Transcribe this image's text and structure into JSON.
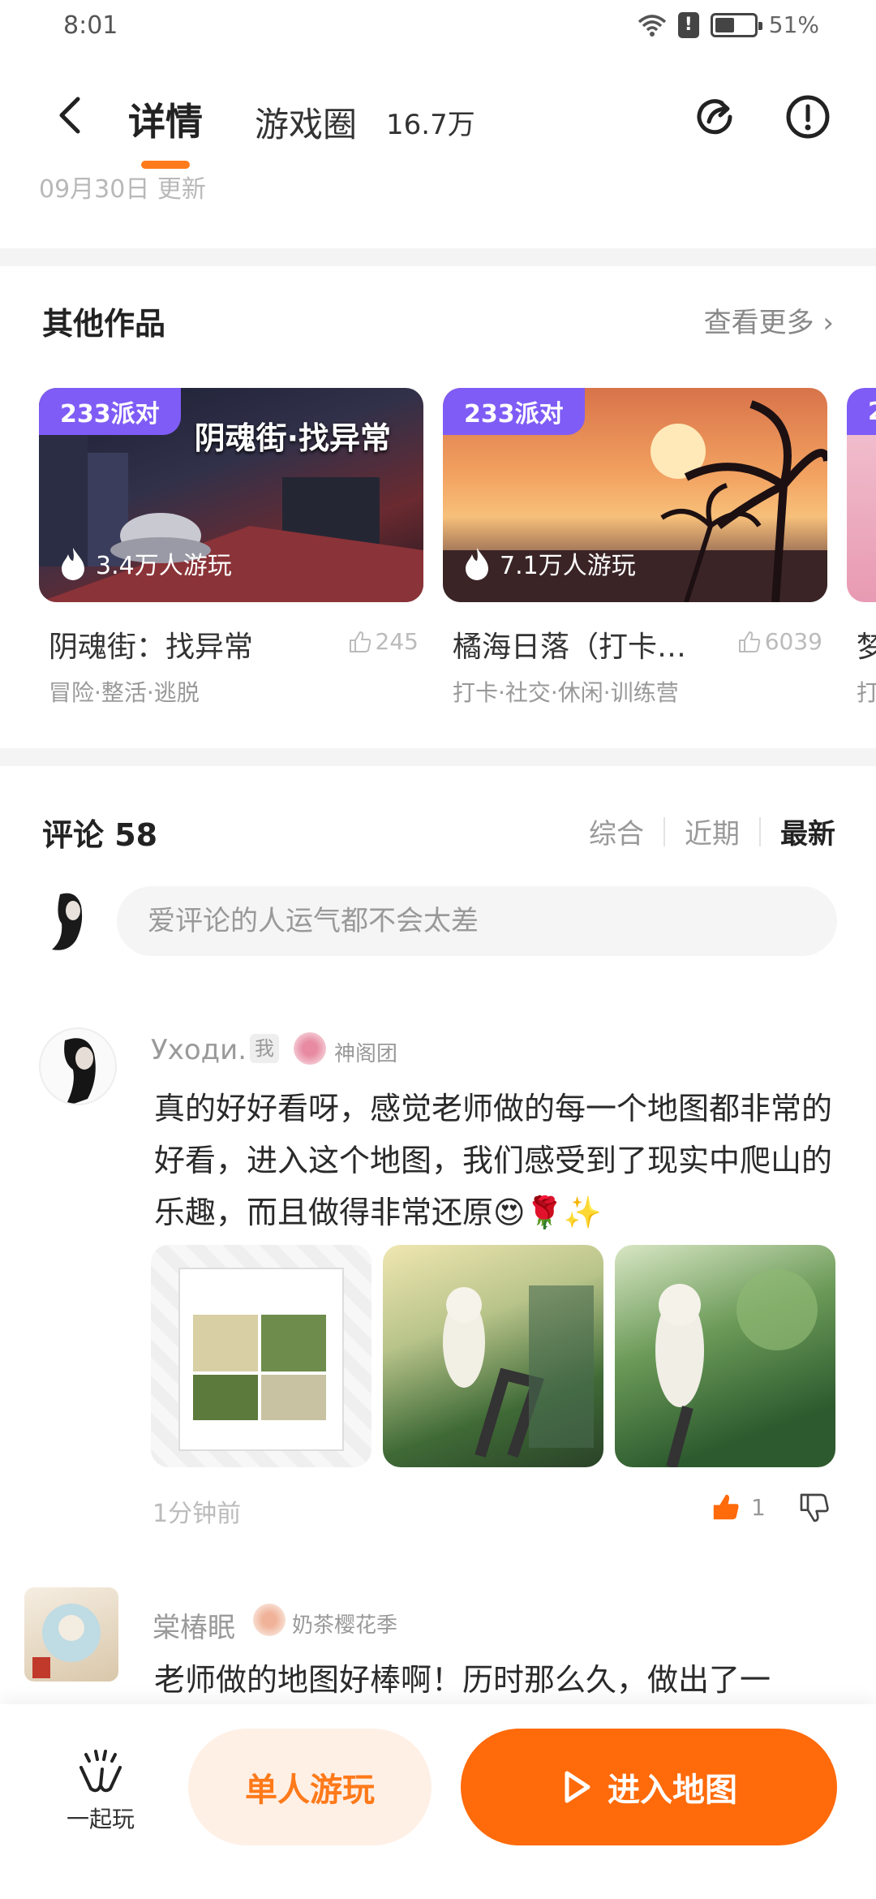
{
  "status": {
    "time": "8:01",
    "battery": "51%",
    "battery_level": 0.51
  },
  "header": {
    "tab_detail": "详情",
    "tab_circle": "游戏圈",
    "circle_count": "16.7万",
    "updated": "09月30日 更新"
  },
  "other_works": {
    "title": "其他作品",
    "more": "查看更多",
    "cards": [
      {
        "badge": "233派对",
        "overlay": "阴魂街·找异常",
        "players": "3.4万人游玩",
        "title": "阴魂街：找异常",
        "likes": "245",
        "tags": "冒险·整活·逃脱"
      },
      {
        "badge": "233派对",
        "players": "7.1万人游玩",
        "title": "橘海日落（打卡…",
        "likes": "6039",
        "tags": "打卡·社交·休闲·训练营"
      },
      {
        "badge": "2",
        "title": "梦",
        "tags": "打"
      }
    ]
  },
  "comments": {
    "title": "评论 58",
    "sort": [
      "综合",
      "近期",
      "最新"
    ],
    "input_placeholder": "爱评论的人运气都不会太差",
    "items": [
      {
        "name": "Уходи.",
        "me_badge": "我",
        "medal": "神阁团",
        "text": "真的好好看呀，感觉老师做的每一个地图都非常的好看，进入这个地图，我们感受到了现实中爬山的乐趣，而且做得非常还原😍🌹✨",
        "time": "1分钟前",
        "likes": "1"
      },
      {
        "name": "棠椿眠",
        "medal": "奶茶樱花季",
        "text": "老师做的地图好棒啊！历时那么久，做出了一"
      }
    ]
  },
  "bottom": {
    "together": "一起玩",
    "solo": "单人游玩",
    "enter": "进入地图"
  },
  "colors": {
    "accent": "#ff6a0a",
    "badge": "#7f5cf6"
  }
}
